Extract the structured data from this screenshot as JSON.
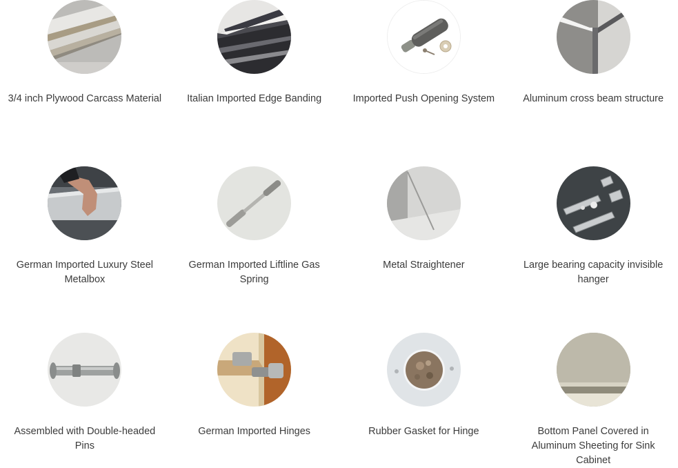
{
  "features": [
    {
      "label": "3/4 inch Plywood Carcass Material",
      "icon": "plywood-icon"
    },
    {
      "label": "Italian Imported Edge Banding",
      "icon": "edge-banding-icon"
    },
    {
      "label": "Imported Push Opening System",
      "icon": "push-opener-icon"
    },
    {
      "label": "Aluminum cross beam structure",
      "icon": "cross-beam-icon"
    },
    {
      "label": "German Imported Luxury Steel Metalbox",
      "icon": "metalbox-drawer-icon"
    },
    {
      "label": "German Imported Liftline Gas Spring",
      "icon": "gas-spring-icon"
    },
    {
      "label": "Metal Straightener",
      "icon": "straightener-icon"
    },
    {
      "label": "Large bearing capacity invisible hanger",
      "icon": "hanger-icon"
    },
    {
      "label": "Assembled with Double-headed Pins",
      "icon": "double-pin-icon"
    },
    {
      "label": "German Imported Hinges",
      "icon": "hinge-icon"
    },
    {
      "label": "Rubber Gasket for Hinge",
      "icon": "rubber-gasket-icon"
    },
    {
      "label": "Bottom Panel Covered in Aluminum Sheeting for Sink Cabinet",
      "icon": "aluminum-bottom-panel-icon"
    }
  ]
}
